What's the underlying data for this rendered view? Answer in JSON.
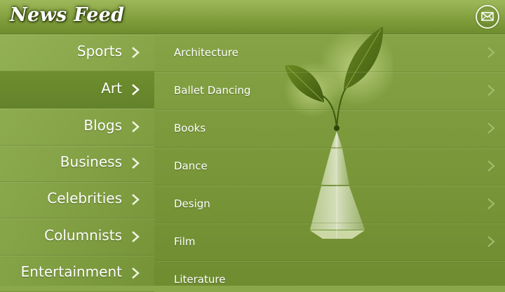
{
  "header": {
    "title": "News Feed",
    "mail_icon": "envelope-icon"
  },
  "categories": [
    {
      "label": "Sports",
      "selected": false
    },
    {
      "label": "Art",
      "selected": true
    },
    {
      "label": "Blogs",
      "selected": false
    },
    {
      "label": "Business",
      "selected": false
    },
    {
      "label": "Celebrities",
      "selected": false
    },
    {
      "label": "Columnists",
      "selected": false
    },
    {
      "label": "Entertainment",
      "selected": false
    }
  ],
  "subcategories": [
    {
      "label": "Architecture"
    },
    {
      "label": "Ballet Dancing"
    },
    {
      "label": "Books"
    },
    {
      "label": "Dance"
    },
    {
      "label": "Design"
    },
    {
      "label": "Film"
    },
    {
      "label": "Literature"
    }
  ],
  "colors": {
    "background": "#7e9c3e",
    "selected_row": "#6f8e2e",
    "left_chevron": "#eef4dc",
    "right_chevron": "#a6bd6e"
  }
}
